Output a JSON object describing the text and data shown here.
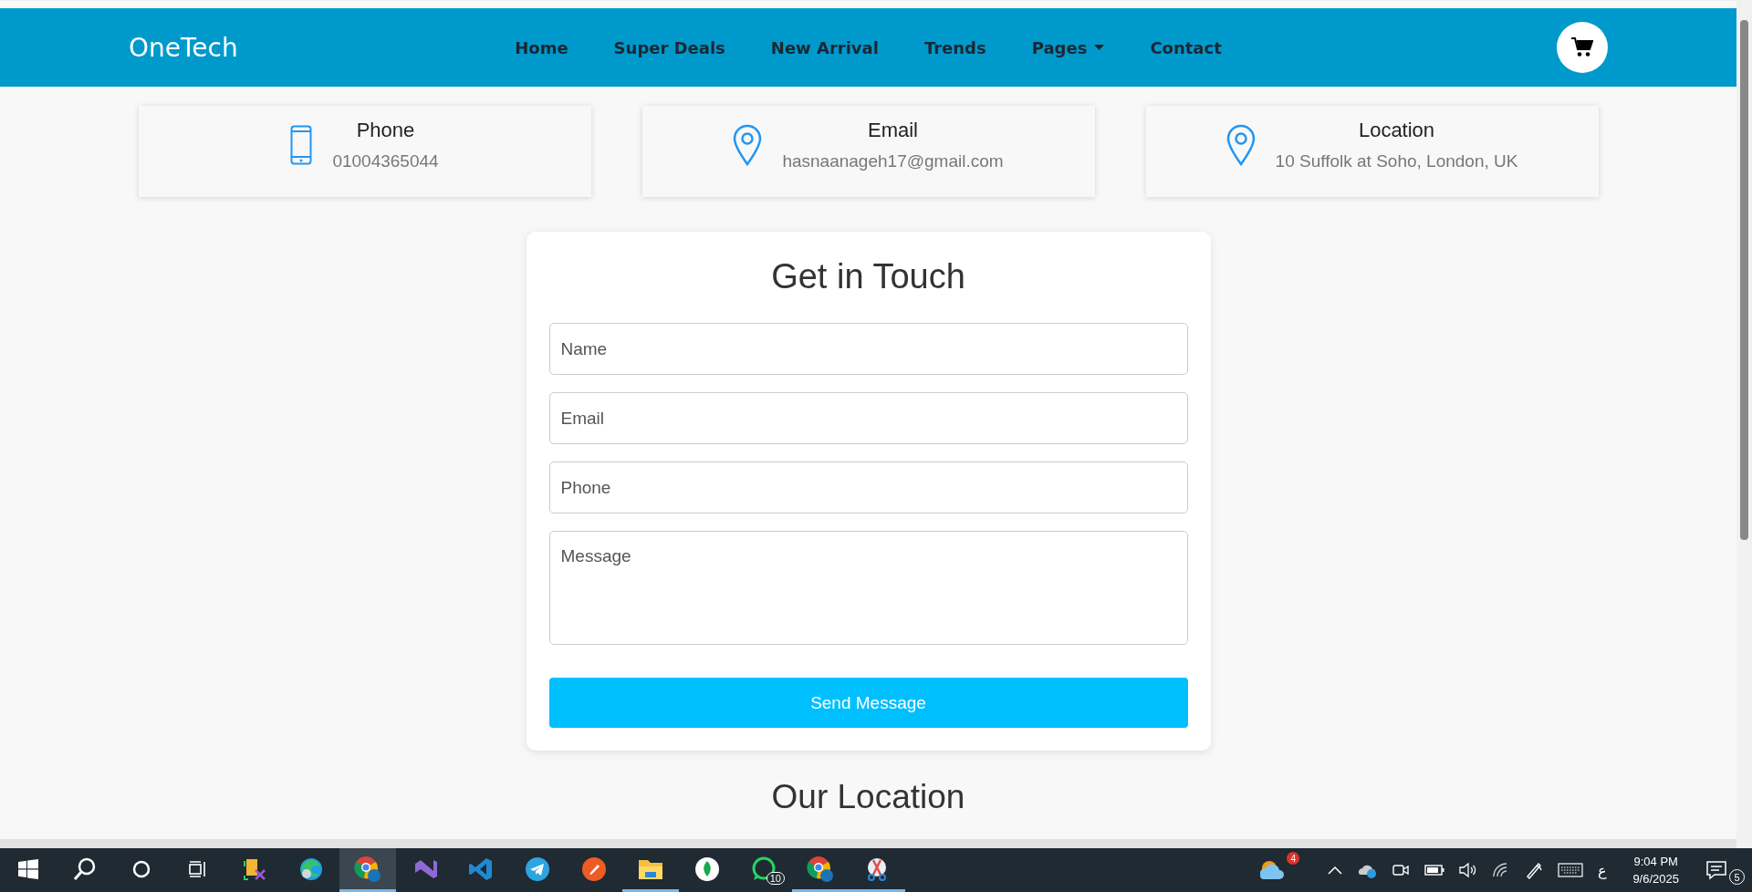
{
  "navbar": {
    "brand": "OneTech",
    "links": [
      {
        "label": "Home",
        "kind": "link"
      },
      {
        "label": "Super Deals",
        "kind": "link"
      },
      {
        "label": "New Arrival",
        "kind": "link"
      },
      {
        "label": "Trends",
        "kind": "link"
      },
      {
        "label": "Pages",
        "kind": "dropdown"
      },
      {
        "label": "Contact",
        "kind": "link"
      }
    ]
  },
  "contact_cards": [
    {
      "kind": "phone",
      "title": "Phone",
      "value": "01004365044"
    },
    {
      "kind": "pin",
      "title": "Email",
      "value": "hasnaanageh17@gmail.com"
    },
    {
      "kind": "pin",
      "title": "Location",
      "value": "10 Suffolk at Soho, London, UK"
    }
  ],
  "form": {
    "title": "Get in Touch",
    "fields": [
      {
        "kind": "input",
        "placeholder": "Name"
      },
      {
        "kind": "input",
        "placeholder": "Email"
      },
      {
        "kind": "input",
        "placeholder": "Phone"
      },
      {
        "kind": "textarea",
        "placeholder": "Message"
      }
    ],
    "button": "Send Message"
  },
  "section_title": "Our Location",
  "taskbar": {
    "apps": [
      {
        "kind": "start",
        "running": false,
        "selected": false
      },
      {
        "kind": "search",
        "running": false,
        "selected": false
      },
      {
        "kind": "cortana",
        "running": false,
        "selected": false
      },
      {
        "kind": "taskview",
        "running": false,
        "selected": false
      },
      {
        "kind": "tools",
        "running": false,
        "selected": false
      },
      {
        "kind": "edge",
        "running": false,
        "selected": false
      },
      {
        "kind": "chrome",
        "running": true,
        "selected": true
      },
      {
        "kind": "studio",
        "running": false,
        "selected": false
      },
      {
        "kind": "vscode",
        "running": false,
        "selected": false
      },
      {
        "kind": "telegram",
        "running": false,
        "selected": false
      },
      {
        "kind": "postman",
        "running": false,
        "selected": false
      },
      {
        "kind": "folder",
        "running": true,
        "selected": false
      },
      {
        "kind": "mongo",
        "running": false,
        "selected": false
      },
      {
        "kind": "whatsapp",
        "running": false,
        "selected": false,
        "badge": "10"
      },
      {
        "kind": "chrome",
        "running": true,
        "selected": false
      },
      {
        "kind": "snip",
        "running": true,
        "selected": false
      }
    ],
    "weather_badge": "4",
    "language": "ع",
    "time": "9:04 PM",
    "date": "9/6/2025",
    "notifications": "5"
  }
}
